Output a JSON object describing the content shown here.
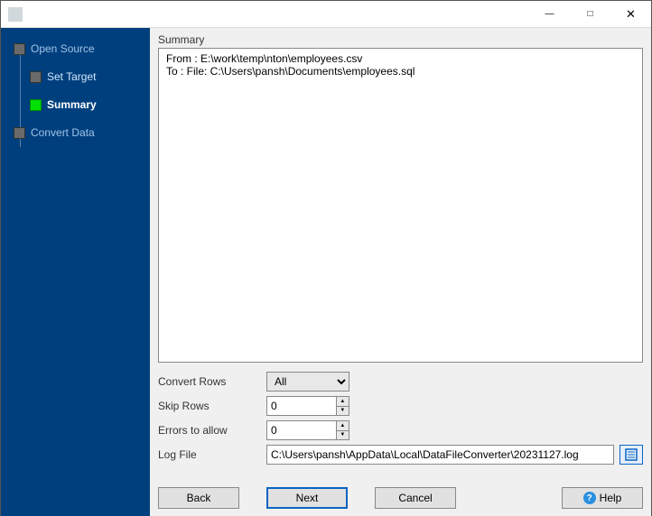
{
  "titlebar": {
    "title": ""
  },
  "steps": {
    "open_source": "Open Source",
    "set_target": "Set Target",
    "summary": "Summary",
    "convert_data": "Convert Data"
  },
  "summary": {
    "label": "Summary",
    "text": "From : E:\\work\\temp\\nton\\employees.csv\nTo : File: C:\\Users\\pansh\\Documents\\employees.sql"
  },
  "fields": {
    "convert_rows": {
      "label": "Convert Rows",
      "value": "All",
      "options": [
        "All"
      ]
    },
    "skip_rows": {
      "label": "Skip Rows",
      "value": "0"
    },
    "errors_allow": {
      "label": "Errors to allow",
      "value": "0"
    },
    "log_file": {
      "label": "Log File",
      "value": "C:\\Users\\pansh\\AppData\\Local\\DataFileConverter\\20231127.log"
    }
  },
  "buttons": {
    "back": "Back",
    "next": "Next",
    "cancel": "Cancel",
    "help": "Help"
  }
}
